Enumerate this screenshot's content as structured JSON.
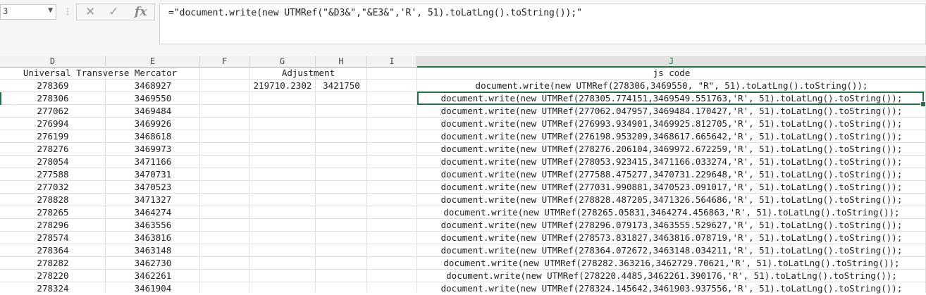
{
  "formula_bar": {
    "name_box": "3",
    "formula": "=\"document.write(new UTMRef(\"&D3&\",\"&E3&\",'R', 51).toLatLng().toString());\""
  },
  "columns": [
    {
      "letter": "D"
    },
    {
      "letter": "E"
    },
    {
      "letter": "F"
    },
    {
      "letter": "G"
    },
    {
      "letter": "H"
    },
    {
      "letter": "I"
    },
    {
      "letter": "J"
    }
  ],
  "headers": {
    "utm": "Universal Transverse Mercator",
    "adjustment": "Adjustment",
    "js": "js code"
  },
  "adjust_row": {
    "D": "278369",
    "E": "3468927",
    "G": "219710.2302",
    "H": "3421750",
    "J": "document.write(new UTMRef(278306,3469550, \"R\", 51).toLatLng().toString());"
  },
  "rows": [
    {
      "D": "278306",
      "E": "3469550",
      "J": "document.write(new UTMRef(278305.774151,3469549.551763,'R', 51).toLatLng().toString());"
    },
    {
      "D": "277062",
      "E": "3469484",
      "J": "document.write(new UTMRef(277062.047957,3469484.170427,'R', 51).toLatLng().toString());"
    },
    {
      "D": "276994",
      "E": "3469926",
      "J": "document.write(new UTMRef(276993.934901,3469925.812705,'R', 51).toLatLng().toString());"
    },
    {
      "D": "276199",
      "E": "3468618",
      "J": "document.write(new UTMRef(276198.953209,3468617.665642,'R', 51).toLatLng().toString());"
    },
    {
      "D": "278276",
      "E": "3469973",
      "J": "document.write(new UTMRef(278276.206104,3469972.672259,'R', 51).toLatLng().toString());"
    },
    {
      "D": "278054",
      "E": "3471166",
      "J": "document.write(new UTMRef(278053.923415,3471166.033274,'R', 51).toLatLng().toString());"
    },
    {
      "D": "277588",
      "E": "3470731",
      "J": "document.write(new UTMRef(277588.475277,3470731.229648,'R', 51).toLatLng().toString());"
    },
    {
      "D": "277032",
      "E": "3470523",
      "J": "document.write(new UTMRef(277031.990881,3470523.091017,'R', 51).toLatLng().toString());"
    },
    {
      "D": "278828",
      "E": "3471327",
      "J": "document.write(new UTMRef(278828.487205,3471326.564686,'R', 51).toLatLng().toString());"
    },
    {
      "D": "278265",
      "E": "3464274",
      "J": "document.write(new UTMRef(278265.05831,3464274.456863,'R', 51).toLatLng().toString());"
    },
    {
      "D": "278296",
      "E": "3463556",
      "J": "document.write(new UTMRef(278296.079173,3463555.529627,'R', 51).toLatLng().toString());"
    },
    {
      "D": "278574",
      "E": "3463816",
      "J": "document.write(new UTMRef(278573.831827,3463816.078719,'R', 51).toLatLng().toString());"
    },
    {
      "D": "278364",
      "E": "3463148",
      "J": "document.write(new UTMRef(278364.072672,3463148.034211,'R', 51).toLatLng().toString());"
    },
    {
      "D": "278282",
      "E": "3462730",
      "J": "document.write(new UTMRef(278282.363216,3462729.70621,'R', 51).toLatLng().toString());"
    },
    {
      "D": "278220",
      "E": "3462261",
      "J": "document.write(new UTMRef(278220.4485,3462261.390176,'R', 51).toLatLng().toString());"
    },
    {
      "D": "278324",
      "E": "3461904",
      "J": "document.write(new UTMRef(278324.145642,3461903.937556,'R', 51).toLatLng().toString());"
    }
  ]
}
